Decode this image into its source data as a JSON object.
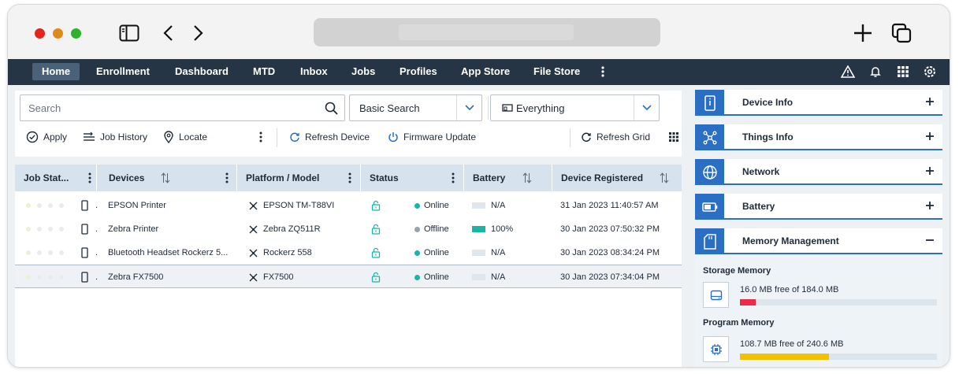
{
  "nav": {
    "items": [
      "Home",
      "Enrollment",
      "Dashboard",
      "MTD",
      "Inbox",
      "Jobs",
      "Profiles",
      "App Store",
      "File Store"
    ]
  },
  "toolbar": {
    "search_placeholder": "Search",
    "search_mode": "Basic Search",
    "scope": "Everything",
    "apply": "Apply",
    "job_history": "Job History",
    "locate": "Locate",
    "refresh_device": "Refresh Device",
    "firmware_update": "Firmware Update",
    "refresh_grid": "Refresh Grid"
  },
  "grid": {
    "columns": [
      "Job Stat...",
      "Devices",
      "Platform / Model",
      "Status",
      "Battery",
      "Device Registered"
    ],
    "rows": [
      {
        "device": "EPSON Printer",
        "model": "EPSON TM-T88VI",
        "status": "Online",
        "battery": "N/A",
        "battery_level": 0,
        "registered": "31 Jan 2023 11:40:57 AM"
      },
      {
        "device": "Zebra Printer",
        "model": "Zebra ZQ511R",
        "status": "Offline",
        "battery": "100%",
        "battery_level": 1.0,
        "registered": "30 Jan 2023 07:50:32 PM"
      },
      {
        "device": "Bluetooth Headset Rockerz 5...",
        "model": "Rockerz 558",
        "status": "Online",
        "battery": "N/A",
        "battery_level": 0,
        "registered": "30 Jan 2023 08:34:24 PM"
      },
      {
        "device": "Zebra FX7500",
        "model": "FX7500",
        "status": "Online",
        "battery": "N/A",
        "battery_level": 0,
        "registered": "30 Jan 2023 07:34:04 PM"
      }
    ]
  },
  "colors": {
    "online": "#19b5a5",
    "offline": "#9aa3ad",
    "accent": "#2a6fc4",
    "storage_bar": "#f0284a",
    "program_bar": "#f2c200"
  },
  "side": {
    "sections": [
      "Device Info",
      "Things Info",
      "Network",
      "Battery",
      "Memory Management"
    ],
    "storage_title": "Storage Memory",
    "storage_text": "16.0 MB free of 184.0 MB",
    "storage_used_fraction": 0.08,
    "program_title": "Program Memory",
    "program_text": "108.7 MB free of 240.6 MB",
    "program_used_fraction": 0.45
  }
}
